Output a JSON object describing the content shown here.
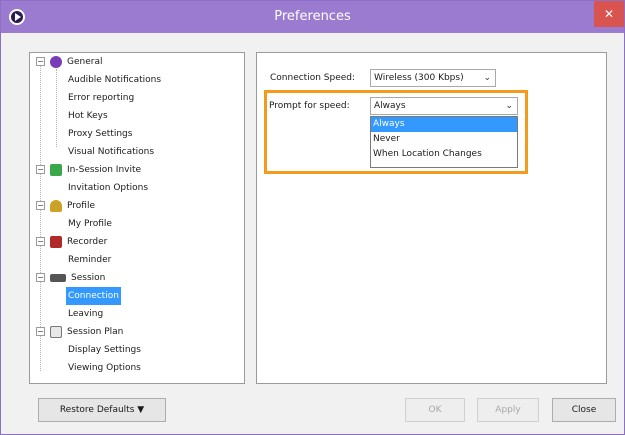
{
  "window": {
    "title": "Preferences",
    "close_glyph": "✕"
  },
  "tree": {
    "items": [
      {
        "label": "General",
        "icon": "general-icon",
        "level": 0
      },
      {
        "label": "Audible Notifications",
        "level": 1
      },
      {
        "label": "Error reporting",
        "level": 1
      },
      {
        "label": "Hot Keys",
        "level": 1
      },
      {
        "label": "Proxy Settings",
        "level": 1
      },
      {
        "label": "Visual Notifications",
        "level": 1
      },
      {
        "label": "In-Session Invite",
        "icon": "invite-icon",
        "level": 0
      },
      {
        "label": "Invitation Options",
        "level": 1
      },
      {
        "label": "Profile",
        "icon": "profile-icon",
        "level": 0
      },
      {
        "label": "My Profile",
        "level": 1
      },
      {
        "label": "Recorder",
        "icon": "recorder-icon",
        "level": 0
      },
      {
        "label": "Reminder",
        "level": 1
      },
      {
        "label": "Session",
        "icon": "session-icon",
        "level": 0
      },
      {
        "label": "Connection",
        "level": 1,
        "selected": true
      },
      {
        "label": "Leaving",
        "level": 1
      },
      {
        "label": "Session Plan",
        "icon": "session-plan-icon",
        "level": 0
      },
      {
        "label": "Display Settings",
        "level": 1
      },
      {
        "label": "Viewing Options",
        "level": 1
      }
    ]
  },
  "panel": {
    "connection_speed": {
      "label": "Connection Speed:",
      "value": "Wireless (300 Kbps)"
    },
    "prompt_for_speed": {
      "label": "Prompt for speed:",
      "value": "Always"
    },
    "dropdown_options": [
      "Always",
      "Never",
      "When Location Changes"
    ],
    "dropdown_selected": "Always"
  },
  "buttons": {
    "restore_defaults": "Restore Defaults ▼",
    "ok": "OK",
    "apply": "Apply",
    "close": "Close"
  },
  "colors": {
    "titlebar": "#9a7bd0",
    "highlight": "#f29b1d",
    "selection": "#3399ff"
  }
}
